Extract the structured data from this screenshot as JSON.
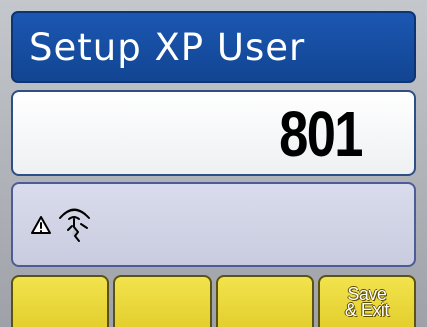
{
  "screen": {
    "title": "Setup XP User",
    "value": "801"
  },
  "status": {
    "icon": "warning-signal-icon"
  },
  "softkeys": [
    {
      "label": ""
    },
    {
      "label": ""
    },
    {
      "label": ""
    },
    {
      "label": "Save\n& Exit"
    }
  ],
  "colors": {
    "title_bar": "#1b57b2",
    "value_box": "#ffffff",
    "status_box": "#d9dcec",
    "softkey": "#f2e34d"
  }
}
